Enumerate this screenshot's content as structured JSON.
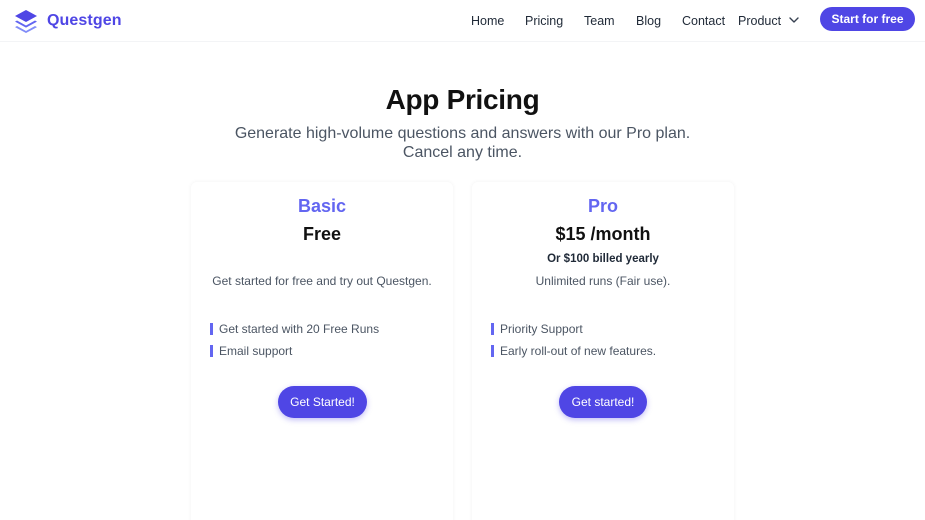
{
  "brand": {
    "name": "Questgen",
    "color": "#4f46e5"
  },
  "nav": {
    "items": [
      {
        "label": "Home"
      },
      {
        "label": "Pricing"
      },
      {
        "label": "Team"
      },
      {
        "label": "Blog"
      },
      {
        "label": "Contact"
      },
      {
        "label": "Product"
      }
    ],
    "cta_label": "Start for free"
  },
  "hero": {
    "title": "App Pricing",
    "subtitle": "Generate high-volume questions and answers with our Pro plan. Cancel any time."
  },
  "plans": [
    {
      "name": "Basic",
      "price": "Free",
      "billed": "",
      "description": "Get started for free and try out Questgen.",
      "features": [
        "Get started with 20 Free Runs",
        "Email support"
      ],
      "button_label": "Get Started!"
    },
    {
      "name": "Pro",
      "price": "$15 /month",
      "billed": "Or $100 billed yearly",
      "description": "Unlimited runs (Fair use).",
      "features": [
        "Priority Support",
        "Early roll-out of new features."
      ],
      "button_label": "Get started!"
    }
  ],
  "colors": {
    "accent": "#6366f1",
    "button": "#4f46e5"
  }
}
